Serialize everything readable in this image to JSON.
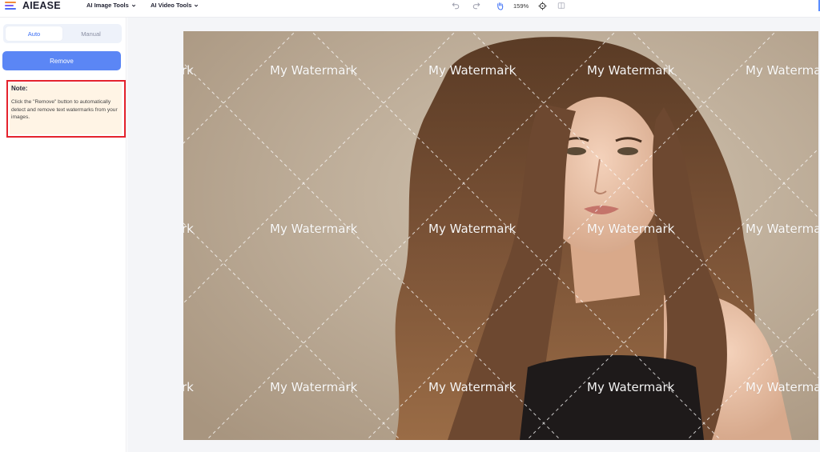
{
  "header": {
    "brand": "AIEASE",
    "nav": [
      {
        "label": "AI Image Tools"
      },
      {
        "label": "AI Video Tools"
      }
    ],
    "zoom": "159%"
  },
  "sidebar": {
    "tabs": [
      {
        "label": "Auto",
        "active": true
      },
      {
        "label": "Manual",
        "active": false
      }
    ],
    "remove_label": "Remove",
    "note": {
      "title": "Note:",
      "text": "Click the \"Remove\" button to automatically detect and remove text watermarks from your images."
    }
  },
  "canvas": {
    "watermark_text": "My Watermark",
    "watermark_partial": "rk",
    "watermark_right_partial": "My Waterma"
  },
  "colors": {
    "accent": "#5b86f5",
    "highlight": "#e5232d",
    "note_bg": "#fff4e5",
    "photo_bg": "#c2b29e"
  }
}
